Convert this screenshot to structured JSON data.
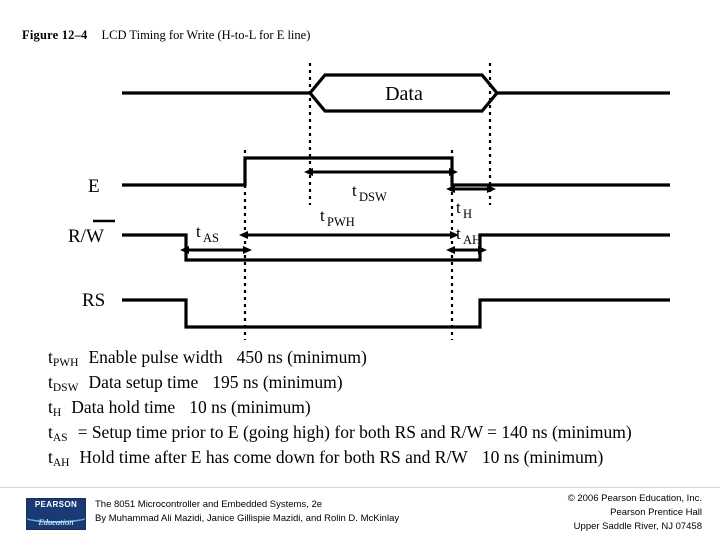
{
  "figure": {
    "number": "Figure 12–4",
    "caption": "LCD Timing for Write (H-to-L for E line)"
  },
  "diagram": {
    "signals": [
      {
        "name": "Data",
        "label": "",
        "bus_value": "Data"
      },
      {
        "name": "E",
        "label": "E"
      },
      {
        "name": "RW",
        "label": "R/W",
        "overline": "W"
      },
      {
        "name": "RS",
        "label": "RS"
      }
    ],
    "timing_marks": [
      {
        "id": "t_DSW",
        "base": "t",
        "sub": "DSW"
      },
      {
        "id": "t_H",
        "base": "t",
        "sub": "H"
      },
      {
        "id": "t_AS",
        "base": "t",
        "sub": "AS"
      },
      {
        "id": "t_PWH",
        "base": "t",
        "sub": "PWH"
      },
      {
        "id": "t_AH",
        "base": "t",
        "sub": "AH"
      }
    ]
  },
  "specs": [
    {
      "symbol": "t",
      "subscript": "PWH",
      "description": "Enable pulse width",
      "value": "450 ns (minimum)",
      "tail": ""
    },
    {
      "symbol": "t",
      "subscript": "DSW",
      "description": "Data setup time",
      "value": "195 ns (minimum)",
      "tail": ""
    },
    {
      "symbol": "t",
      "subscript": "H",
      "description": "Data hold time",
      "value": "10 ns (minimum)",
      "tail": ""
    },
    {
      "symbol": "t",
      "subscript": "AS",
      "description": "= Setup time prior to E (going high) for both RS and R/W = 140 ns (minimum)",
      "value": "",
      "tail": ""
    },
    {
      "symbol": "t",
      "subscript": "AH",
      "description": "Hold time after E has come down for both RS and R/W",
      "value": "10 ns (minimum)",
      "tail": ""
    }
  ],
  "footer": {
    "logo": {
      "top_text": "PEARSON",
      "bottom_text": "Education"
    },
    "book_title": "The 8051 Microcontroller and Embedded Systems, 2e",
    "book_authors": "By Muhammad Ali Mazidi, Janice Gillispie Mazidi, and Rolin D. McKinlay",
    "copyright_line1": "© 2006 Pearson Education, Inc.",
    "copyright_line2": "Pearson Prentice Hall",
    "copyright_line3": "Upper Saddle River, NJ 07458"
  },
  "colors": {
    "ink": "#000000",
    "background": "#ffffff",
    "logo_blue": "#1b3a73",
    "logo_swoosh": "#4fb9e8"
  }
}
